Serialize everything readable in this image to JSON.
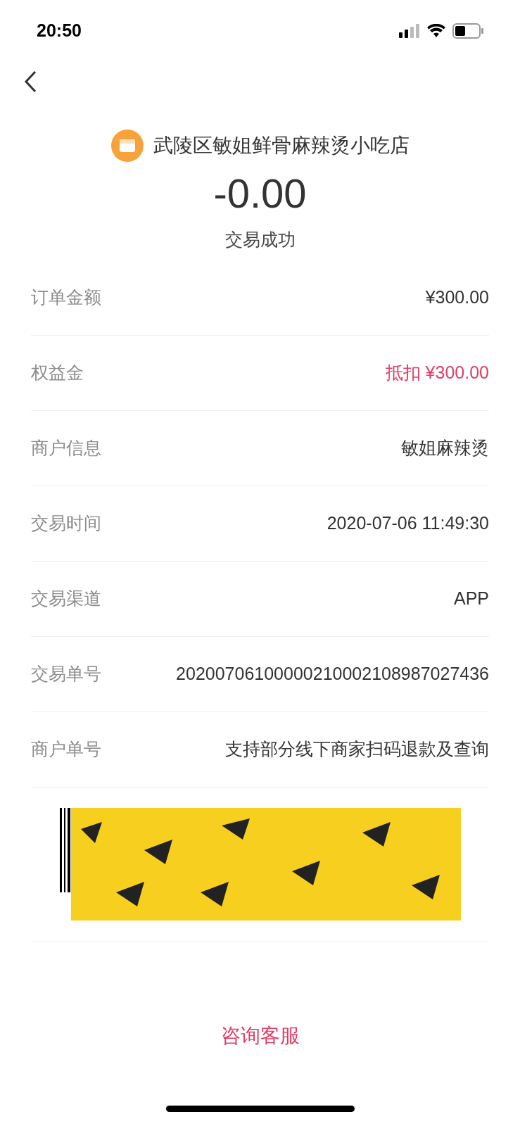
{
  "status_bar": {
    "time": "20:50"
  },
  "merchant": {
    "name": "武陵区敏姐鲜骨麻辣烫小吃店"
  },
  "amount": "-0.00",
  "status": "交易成功",
  "rows": [
    {
      "label": "订单金额",
      "value": "¥300.00",
      "highlight": false
    },
    {
      "label": "权益金",
      "value": "抵扣 ¥300.00",
      "highlight": true
    },
    {
      "label": "商户信息",
      "value": "敏姐麻辣烫",
      "highlight": false
    },
    {
      "label": "交易时间",
      "value": "2020-07-06 11:49:30",
      "highlight": false
    },
    {
      "label": "交易渠道",
      "value": "APP",
      "highlight": false
    },
    {
      "label": "交易单号",
      "value": "20200706100000210002108987027436",
      "highlight": false
    },
    {
      "label": "商户单号",
      "value": "支持部分线下商家扫码退款及查询",
      "highlight": false
    }
  ],
  "support_button": "咨询客服"
}
